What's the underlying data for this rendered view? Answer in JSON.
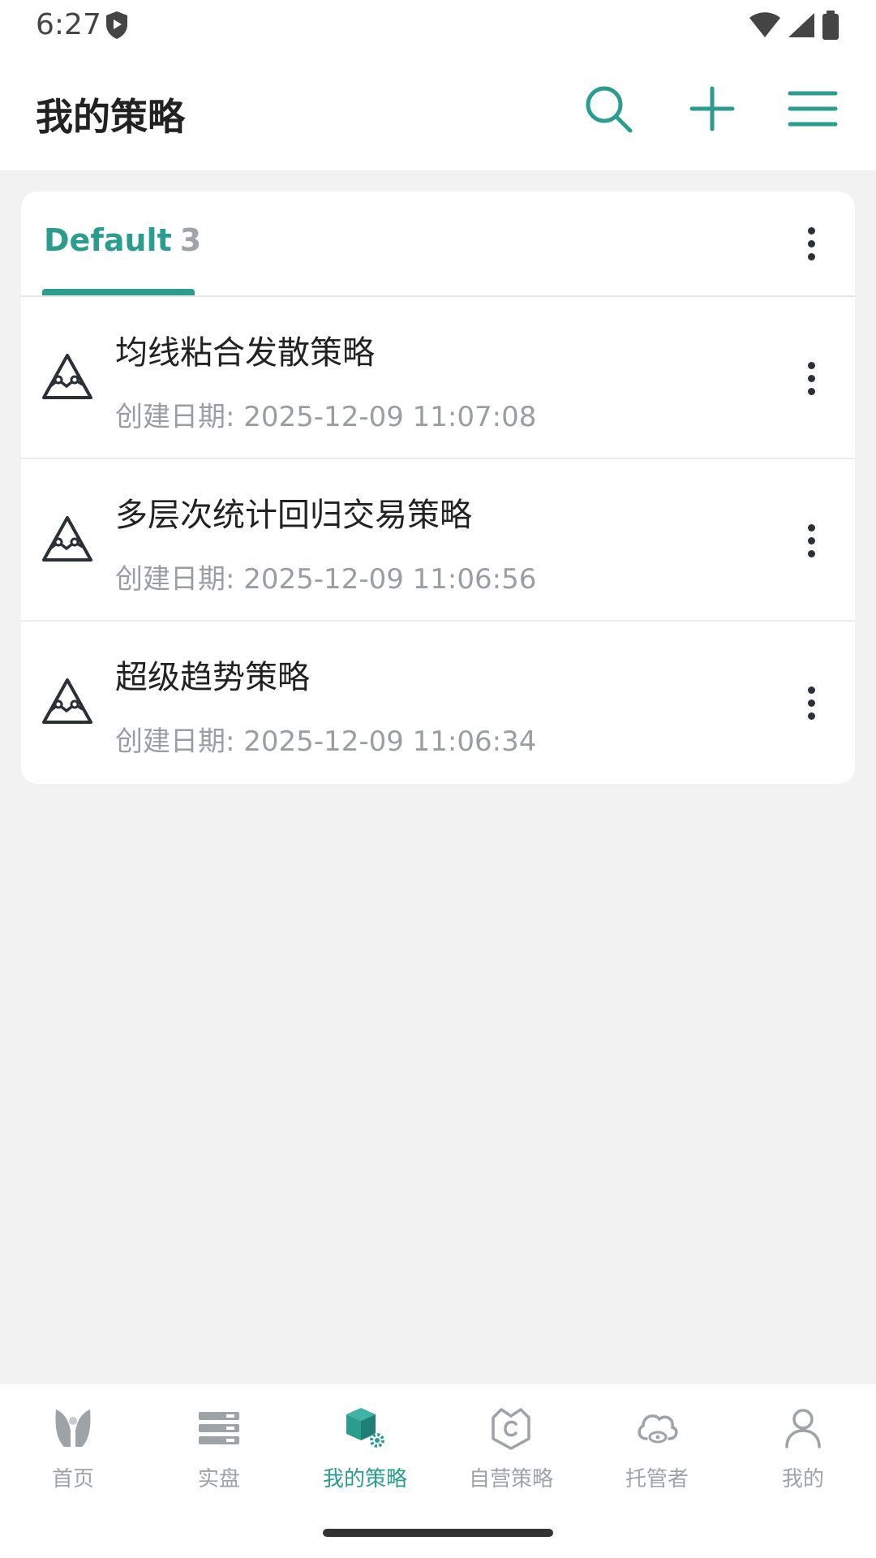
{
  "status": {
    "time": "6:27"
  },
  "header": {
    "title": "我的策略"
  },
  "group": {
    "name": "Default",
    "count": "3"
  },
  "strategies": [
    {
      "name": "均线粘合发散策略",
      "date": "创建日期: 2025-12-09 11:07:08"
    },
    {
      "name": "多层次统计回归交易策略",
      "date": "创建日期: 2025-12-09 11:06:56"
    },
    {
      "name": "超级趋势策略",
      "date": "创建日期: 2025-12-09 11:06:34"
    }
  ],
  "nav": [
    {
      "label": "首页",
      "icon": "home-logo-icon"
    },
    {
      "label": "实盘",
      "icon": "server-stack-icon"
    },
    {
      "label": "我的策略",
      "icon": "strategy-cube-icon",
      "active": true
    },
    {
      "label": "自营策略",
      "icon": "crown-shield-icon"
    },
    {
      "label": "托管者",
      "icon": "cloud-eye-icon"
    },
    {
      "label": "我的",
      "icon": "user-icon"
    }
  ],
  "colors": {
    "accent": "#2a9d8f",
    "muted": "#9ea3a8",
    "background": "#f2f2f2"
  }
}
